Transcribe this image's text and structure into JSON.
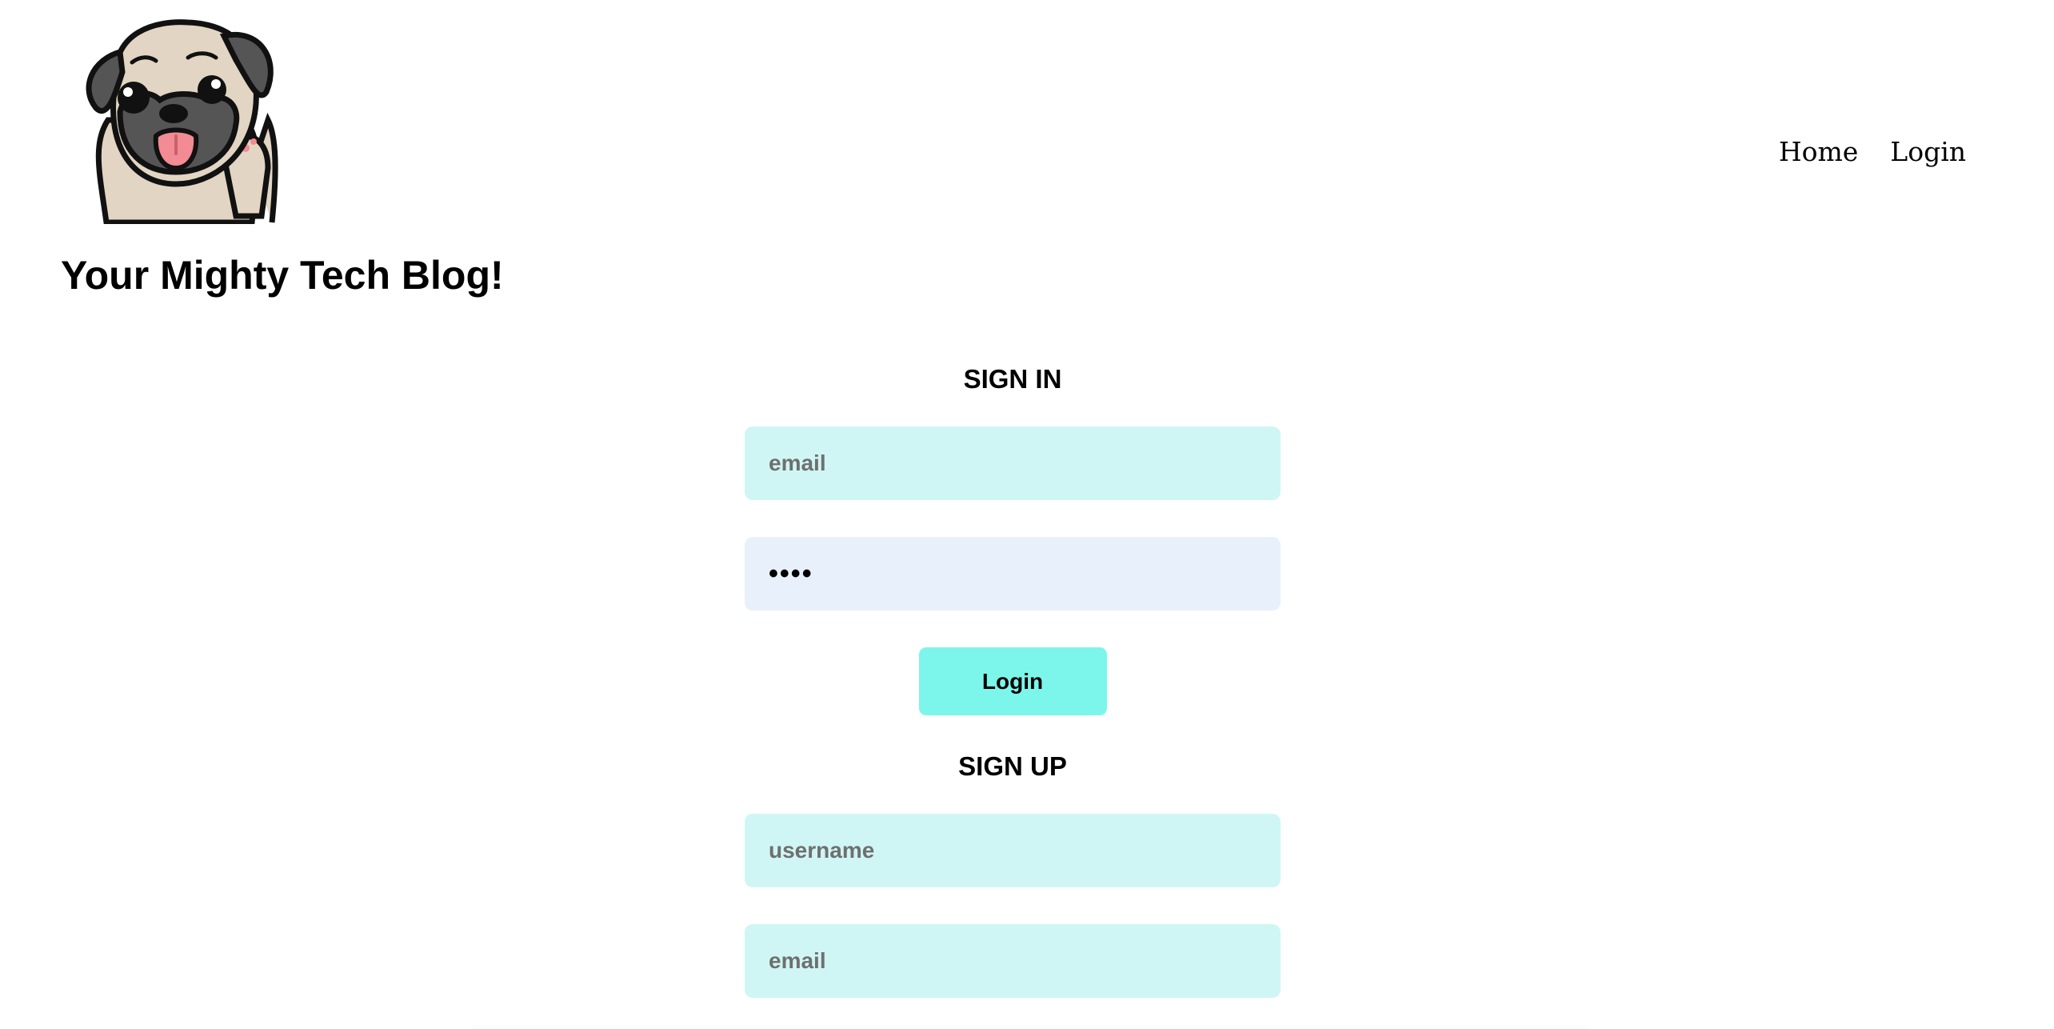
{
  "header": {
    "title": "Your Mighty Tech Blog!",
    "logo_icon": "pug-waving-icon",
    "nav": {
      "home_label": "Home",
      "login_label": "Login"
    }
  },
  "sign_in": {
    "heading": "SIGN IN",
    "email_placeholder": "email",
    "password_value": "••••",
    "login_button_label": "Login"
  },
  "sign_up": {
    "heading": "SIGN UP",
    "username_placeholder": "username",
    "email_placeholder": "email"
  },
  "colors": {
    "input_bg": "#cff6f5",
    "password_bg": "#e8f0fb",
    "button_bg": "#7cf6ea",
    "pug_fur": "#e2d5c3",
    "pug_mask": "#555555",
    "pug_tongue": "#f28b93"
  }
}
